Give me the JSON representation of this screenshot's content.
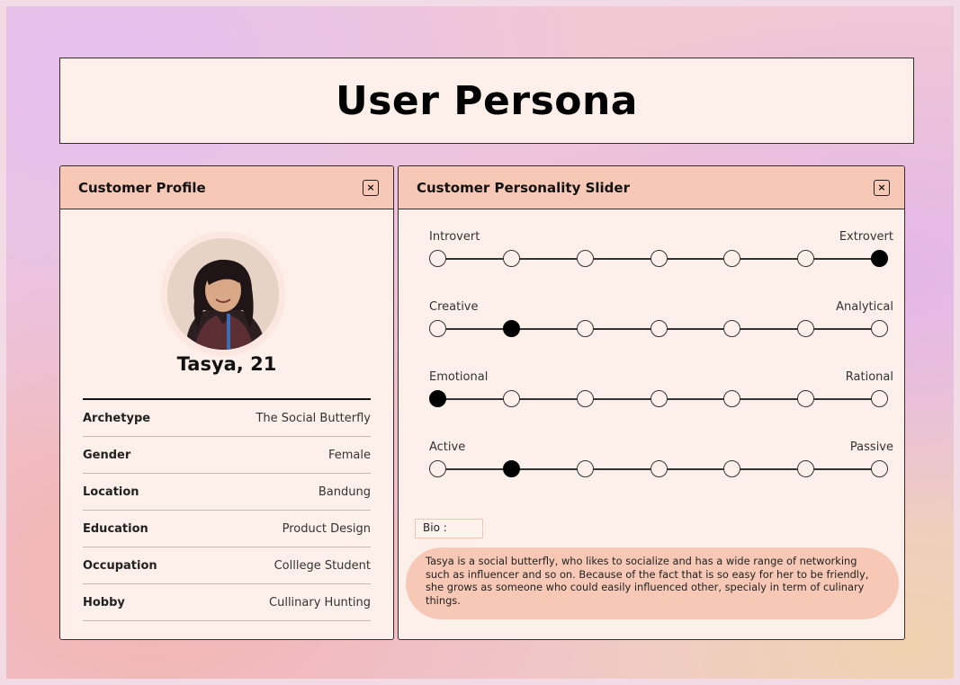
{
  "page": {
    "title": "User Persona"
  },
  "profile": {
    "header_title": "Customer Profile",
    "close_label": "×",
    "name": "Tasya, 21",
    "rows": [
      {
        "key": "Archetype",
        "value": "The Social Butterfly"
      },
      {
        "key": "Gender",
        "value": "Female"
      },
      {
        "key": "Location",
        "value": "Bandung"
      },
      {
        "key": "Education",
        "value": "Product Design"
      },
      {
        "key": "Occupation",
        "value": "Colllege Student"
      },
      {
        "key": "Hobby",
        "value": "Cullinary Hunting"
      }
    ]
  },
  "slider": {
    "header_title": "Customer Personality Slider",
    "close_label": "×",
    "scales": [
      {
        "left": "Introvert",
        "right": "Extrovert",
        "steps": 7,
        "selected": 7
      },
      {
        "left": "Creative",
        "right": "Analytical",
        "steps": 7,
        "selected": 2
      },
      {
        "left": "Emotional",
        "right": "Rational",
        "steps": 7,
        "selected": 1
      },
      {
        "left": "Active",
        "right": "Passive",
        "steps": 7,
        "selected": 2
      }
    ],
    "bio_label": "Bio :",
    "bio_text": "Tasya is a social butterfly, who likes to socialize and has a wide range of networking such as influencer and so on. Because of the fact that is so easy for her to be friendly, she grows as someone who could easily influenced other, specialy in term of culinary things."
  },
  "colors": {
    "header_bg": "#f6c8b5",
    "panel_bg": "#fdf0ea",
    "bio_bg": "#f6c8b5",
    "selected_dot": "#000000"
  }
}
